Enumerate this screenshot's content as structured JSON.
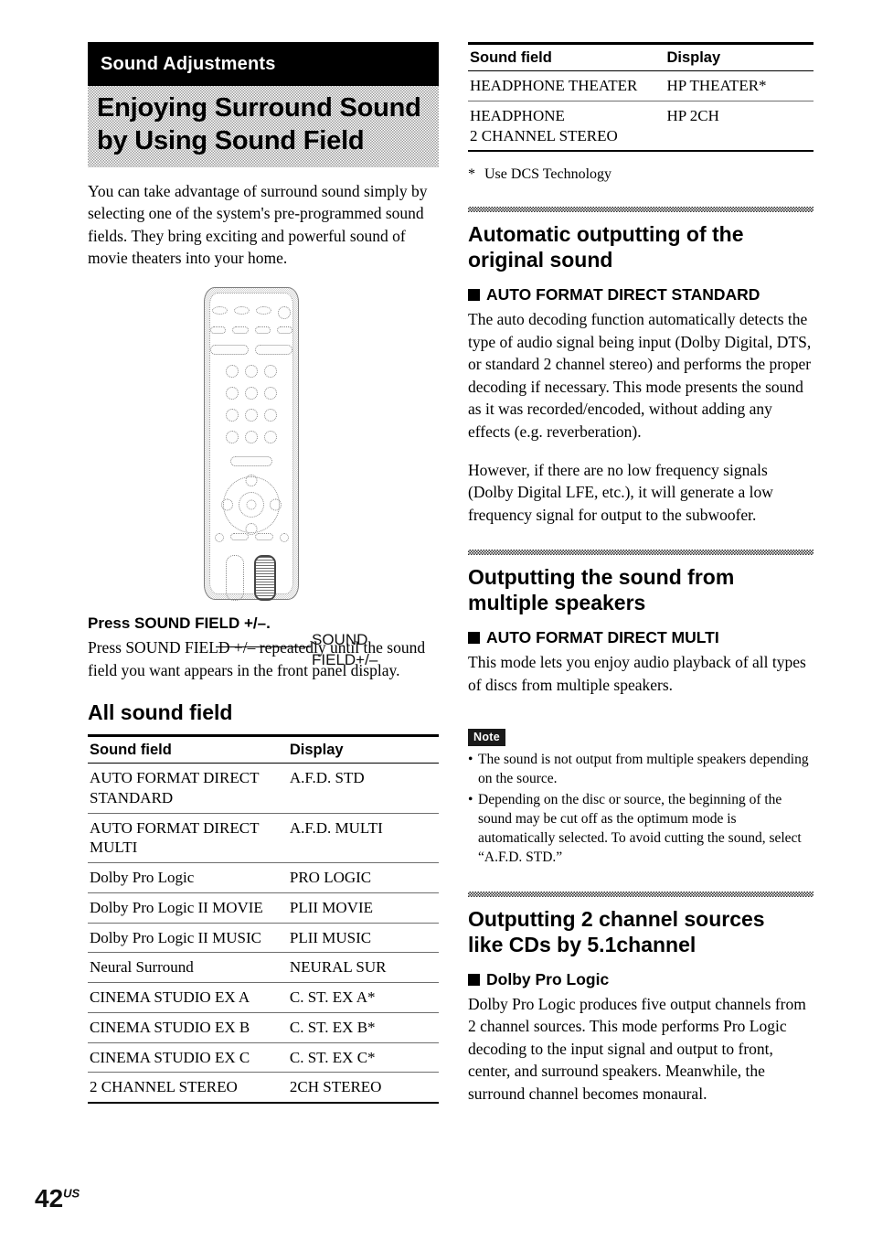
{
  "chapter": {
    "banner_label": "Sound Adjustments",
    "title_line1": "Enjoying Surround Sound",
    "title_line2": "by Using Sound Field"
  },
  "intro": {
    "paragraph": "You can take advantage of surround sound simply by selecting one of the system's pre-programmed sound fields. They bring exciting and powerful sound of movie theaters into your home."
  },
  "figure": {
    "callout_line1": "SOUND",
    "callout_line2": "FIELD+/–"
  },
  "instruction": {
    "heading": "Press SOUND FIELD +/–.",
    "paragraph": "Press SOUND FIELD +/– repeatedly until the sound field you want appears in the front panel display."
  },
  "all_sound_field": {
    "heading": "All sound field",
    "columns": [
      "Sound field",
      "Display"
    ],
    "rows": [
      [
        "AUTO FORMAT DIRECT STANDARD",
        "A.F.D. STD"
      ],
      [
        "AUTO FORMAT DIRECT MULTI",
        "A.F.D. MULTI"
      ],
      [
        "Dolby Pro Logic",
        "PRO LOGIC"
      ],
      [
        "Dolby Pro Logic II MOVIE",
        "PLII MOVIE"
      ],
      [
        "Dolby Pro Logic II MUSIC",
        "PLII MUSIC"
      ],
      [
        "Neural Surround",
        "NEURAL SUR"
      ],
      [
        "CINEMA STUDIO EX A",
        "C. ST. EX A*"
      ],
      [
        "CINEMA STUDIO EX B",
        "C. ST. EX B*"
      ],
      [
        "CINEMA STUDIO EX C",
        "C. ST. EX C*"
      ],
      [
        "2 CHANNEL STEREO",
        "2CH STEREO"
      ]
    ]
  },
  "headphone_table": {
    "columns": [
      "Sound field",
      "Display"
    ],
    "rows": [
      [
        "HEADPHONE THEATER",
        "HP THEATER*"
      ],
      [
        "HEADPHONE\n2 CHANNEL STEREO",
        "HP 2CH"
      ]
    ],
    "footnote_marker": "*",
    "footnote_text": "Use DCS Technology"
  },
  "section_auto": {
    "title_line1": "Automatic outputting of the",
    "title_line2": "original sound",
    "subheading": "AUTO FORMAT DIRECT STANDARD",
    "paragraph1": "The auto decoding function automatically detects the type of audio signal being input (Dolby Digital, DTS, or standard 2 channel stereo) and performs the proper decoding if necessary. This mode presents the sound as it was recorded/encoded, without adding any effects (e.g. reverberation).",
    "paragraph2": "However, if there are no low frequency signals (Dolby Digital LFE, etc.), it will generate a low frequency signal for output to the subwoofer."
  },
  "section_multi": {
    "title_line1": "Outputting the sound from",
    "title_line2": "multiple speakers",
    "subheading": "AUTO FORMAT DIRECT MULTI",
    "paragraph": "This mode lets you enjoy audio playback of all types of discs from multiple speakers.",
    "note_badge": "Note",
    "notes": [
      "The sound is not output from multiple speakers depending on the source.",
      "Depending on the disc or source, the beginning of the sound may be cut off as the optimum mode is automatically selected. To avoid cutting the sound, select “A.F.D. STD.”"
    ]
  },
  "section_prologic": {
    "title_line1": "Outputting 2 channel sources",
    "title_line2": "like CDs by 5.1channel",
    "subheading": "Dolby Pro Logic",
    "paragraph": "Dolby Pro Logic produces five output channels from 2 channel sources. This mode performs Pro Logic decoding to the input signal and output to front, center, and surround speakers. Meanwhile, the surround channel becomes monaural."
  },
  "footer": {
    "page_number": "42",
    "page_suffix": "US"
  }
}
